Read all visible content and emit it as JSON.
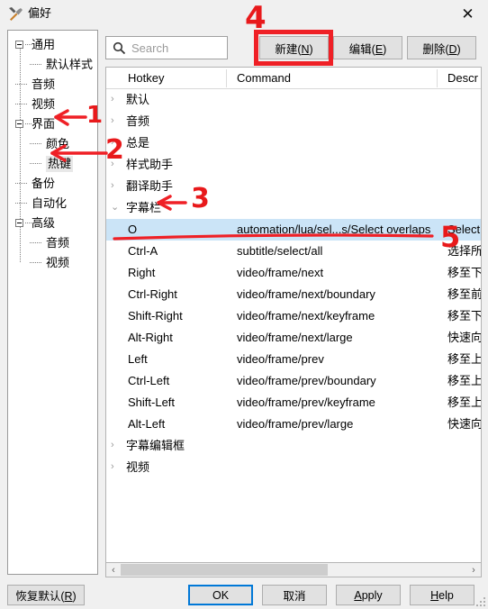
{
  "window": {
    "title": "偏好",
    "icon": "hammer-wrench-icon",
    "close_label": "✕"
  },
  "sidebar": {
    "items": [
      {
        "label": "通用",
        "level": 0,
        "expander": "minus"
      },
      {
        "label": "默认样式",
        "level": 1,
        "expander": "none"
      },
      {
        "label": "音频",
        "level": 0,
        "expander": "none"
      },
      {
        "label": "视频",
        "level": 0,
        "expander": "none"
      },
      {
        "label": "界面",
        "level": 0,
        "expander": "minus"
      },
      {
        "label": "颜色",
        "level": 1,
        "expander": "none"
      },
      {
        "label": "热键",
        "level": 1,
        "expander": "none",
        "selected": true
      },
      {
        "label": "备份",
        "level": 0,
        "expander": "none"
      },
      {
        "label": "自动化",
        "level": 0,
        "expander": "none"
      },
      {
        "label": "高级",
        "level": 0,
        "expander": "minus"
      },
      {
        "label": "音频",
        "level": 1,
        "expander": "none"
      },
      {
        "label": "视频",
        "level": 1,
        "expander": "none"
      }
    ]
  },
  "toolbar": {
    "search_placeholder": "Search",
    "search_value": "",
    "search_icon": "search-icon",
    "new_label": "新建(N)",
    "new_mnemonic": "N",
    "edit_label": "编辑(E)",
    "edit_mnemonic": "E",
    "delete_label": "删除(D)",
    "delete_mnemonic": "D"
  },
  "list": {
    "columns": [
      {
        "key": "hotkey",
        "label": "Hotkey"
      },
      {
        "key": "command",
        "label": "Command"
      },
      {
        "key": "description",
        "label": "Descr"
      }
    ],
    "groups": [
      {
        "name": "默认",
        "expanded": false
      },
      {
        "name": "音频",
        "expanded": false
      },
      {
        "name": "总是",
        "expanded": false
      },
      {
        "name": "样式助手",
        "expanded": false
      },
      {
        "name": "翻译助手",
        "expanded": false
      },
      {
        "name": "字幕栏",
        "expanded": true,
        "rows": [
          {
            "hotkey": "O",
            "command": "automation/lua/sel...s/Select overlaps",
            "description": "Select",
            "selected": true
          },
          {
            "hotkey": "Ctrl-A",
            "command": "subtitle/select/all",
            "description": "选择所"
          },
          {
            "hotkey": "Right",
            "command": "video/frame/next",
            "description": "移至下"
          },
          {
            "hotkey": "Ctrl-Right",
            "command": "video/frame/next/boundary",
            "description": "移至前"
          },
          {
            "hotkey": "Shift-Right",
            "command": "video/frame/next/keyframe",
            "description": "移至下"
          },
          {
            "hotkey": "Alt-Right",
            "command": "video/frame/next/large",
            "description": "快速向"
          },
          {
            "hotkey": "Left",
            "command": "video/frame/prev",
            "description": "移至上"
          },
          {
            "hotkey": "Ctrl-Left",
            "command": "video/frame/prev/boundary",
            "description": "移至上"
          },
          {
            "hotkey": "Shift-Left",
            "command": "video/frame/prev/keyframe",
            "description": "移至上"
          },
          {
            "hotkey": "Alt-Left",
            "command": "video/frame/prev/large",
            "description": "快速向"
          }
        ]
      },
      {
        "name": "字幕编辑框",
        "expanded": false
      },
      {
        "name": "视频",
        "expanded": false
      }
    ],
    "chevron_collapsed": "›",
    "chevron_expanded": "⌄"
  },
  "scrollbar": {
    "left_arrow": "‹",
    "right_arrow": "›"
  },
  "footer": {
    "reset_label": "恢复默认(R)",
    "ok_label": "OK",
    "cancel_label": "取消",
    "apply_label": "Apply",
    "help_label": "Help"
  },
  "annotations": {
    "color": "#ef2026",
    "marks": [
      {
        "id": "1",
        "text": "1",
        "points_to": "界面"
      },
      {
        "id": "2",
        "text": "2",
        "points_to": "热键"
      },
      {
        "id": "3",
        "text": "3",
        "points_to": "字幕栏"
      },
      {
        "id": "4",
        "text": "4",
        "points_to": "新建(N)"
      },
      {
        "id": "5",
        "text": "5",
        "points_to": "selected-row"
      }
    ]
  }
}
